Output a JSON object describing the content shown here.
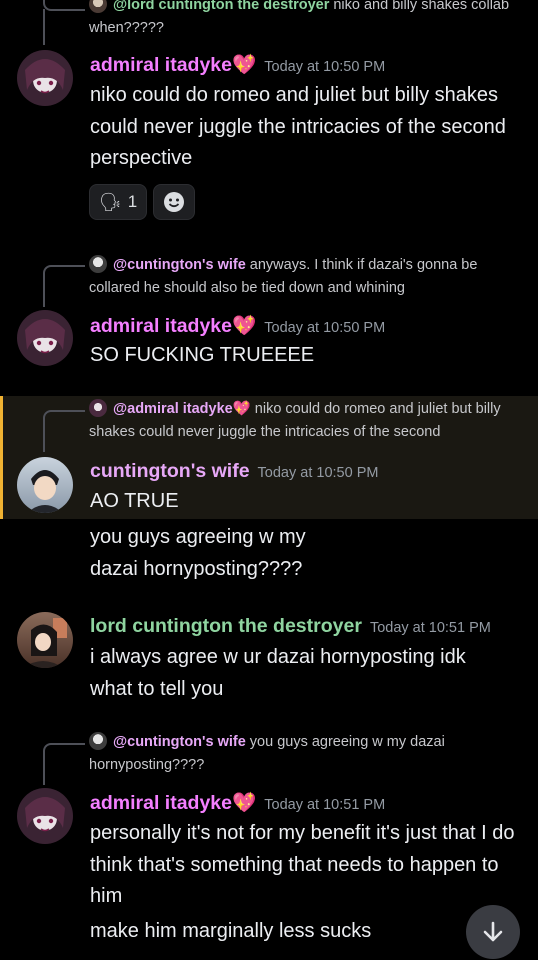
{
  "colors": {
    "pink_name": "#f47fff",
    "green_name": "#8fd4a0",
    "pink_mention": "#e7a8f7",
    "highlight_border": "#f0b232"
  },
  "messages": [
    {
      "reply": {
        "mention": "@lord cuntington the destroyer",
        "text": "niko and billy shakes collab when?????"
      }
    },
    {
      "author": "admiral itadyke",
      "emoji": "💖",
      "time": "Today at 10:50 PM",
      "lines": [
        "niko could do romeo and juliet but billy shakes could never juggle the intricacies of the second perspective"
      ],
      "reactions": [
        {
          "icon": "speaking-head-icon",
          "count": "1"
        },
        {
          "icon": "add-reaction-icon"
        }
      ]
    },
    {
      "reply": {
        "mention": "@cuntington's wife",
        "text": "anyways. I think if dazai's gonna be collared he should also be tied down and whining"
      },
      "author": "admiral itadyke",
      "emoji": "💖",
      "time": "Today at 10:50 PM",
      "lines": [
        "SO FUCKING TRUEEEE"
      ]
    },
    {
      "reply": {
        "mention": "@admiral itadyke",
        "emoji": "💖",
        "text": "niko could do romeo and juliet but billy shakes could never juggle the intricacies of the second"
      },
      "author": "cuntington's wife",
      "time": "Today at 10:50 PM",
      "lines": [
        "AO TRUE",
        "you guys agreeing w my dazai hornyposting????"
      ]
    },
    {
      "author": "lord cuntington the destroyer",
      "time": "Today at 10:51 PM",
      "lines": [
        "i always agree w ur dazai hornyposting idk what to tell you"
      ]
    },
    {
      "reply": {
        "mention": "@cuntington's wife",
        "text": "you guys agreeing w my dazai hornyposting????"
      },
      "author": "admiral itadyke",
      "emoji": "💖",
      "time": "Today at 10:51 PM",
      "lines": [
        "personally it's not for my benefit it's just that I do think that's something that needs to happen to him",
        "make him marginally less sucks"
      ]
    }
  ],
  "scroll_button": {
    "icon": "arrow-down-icon"
  }
}
